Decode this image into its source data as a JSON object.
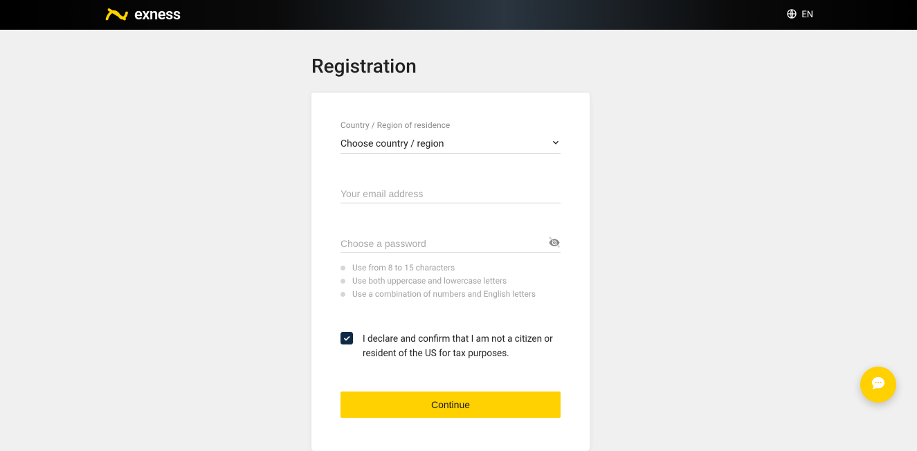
{
  "header": {
    "brand": "exness",
    "language_label": "EN"
  },
  "page": {
    "title": "Registration"
  },
  "form": {
    "country": {
      "label": "Country / Region of residence",
      "placeholder": "Choose country / region"
    },
    "email": {
      "placeholder": "Your email address"
    },
    "password": {
      "placeholder": "Choose a password",
      "hints": [
        "Use from 8 to 15 characters",
        "Use both uppercase and lowercase letters",
        "Use a combination of numbers and English letters"
      ]
    },
    "declaration": {
      "checked": true,
      "text": "I declare and confirm that I am not a citizen or resident of the US for tax purposes."
    },
    "continue_label": "Continue"
  },
  "colors": {
    "accent": "#ffd100",
    "checkbox_bg": "#0e2a47"
  }
}
